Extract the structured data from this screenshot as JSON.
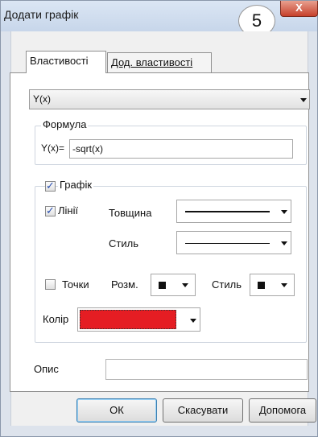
{
  "window": {
    "title": "Додати графік",
    "step_badge": "5",
    "close_glyph": "X"
  },
  "tabs": [
    {
      "label": "Властивості",
      "active": true
    },
    {
      "label": "Дод. властивості",
      "active": false
    }
  ],
  "function_type": {
    "selected": "Y(x)"
  },
  "formula": {
    "group_label": "Формула",
    "prefix": "Y(x)=",
    "value": "-sqrt(x)"
  },
  "graph": {
    "label": "Графік",
    "checked": true,
    "lines": {
      "label": "Лінії",
      "checked": true
    },
    "thickness_label": "Товщина",
    "style_label": "Стиль",
    "points": {
      "label": "Точки",
      "checked": false
    },
    "point_size_label": "Розм.",
    "point_style_label": "Стиль",
    "color_label": "Колір",
    "color": "#e51d23"
  },
  "description": {
    "label": "Опис",
    "value": ""
  },
  "buttons": {
    "ok": "ОК",
    "cancel": "Скасувати",
    "help": "Допомога"
  }
}
